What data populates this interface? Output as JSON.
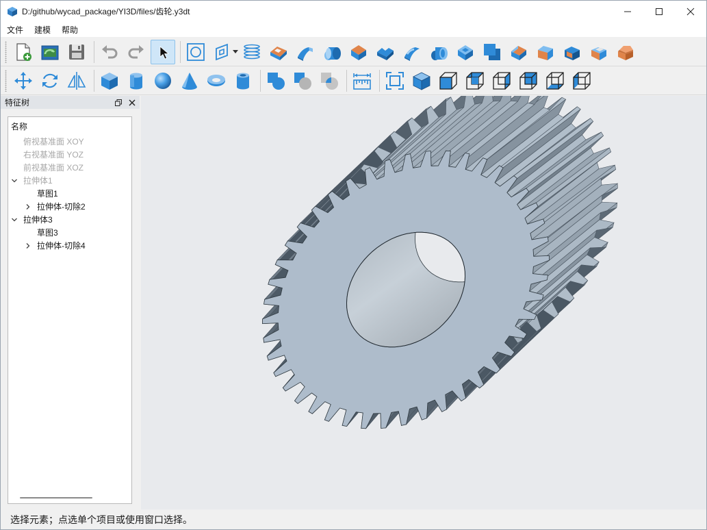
{
  "window": {
    "title": "D:/github/wycad_package/YI3D/files/齿轮.y3dt"
  },
  "menu": {
    "items": [
      "文件",
      "建模",
      "帮助"
    ]
  },
  "toolbar1": {
    "buttons": [
      "new-file-icon",
      "open-file-icon",
      "save-icon",
      "undo-icon",
      "redo-icon",
      "select-pointer-icon",
      "circle-sketch-icon",
      "plane-sketch-icon",
      "helix-icon",
      "extrude-icon",
      "revolve-icon",
      "sweep-icon",
      "loft-icon",
      "extrude-cut-icon",
      "revolve-cut-icon",
      "sweep-cut-icon",
      "loft-cut-icon",
      "shell-icon",
      "thicken-icon",
      "chamfer-icon",
      "fillet-icon",
      "draft-icon",
      "pyramid-icon"
    ],
    "selected": "select-pointer-icon"
  },
  "toolbar2": {
    "buttons": [
      "move-icon",
      "rotate-icon",
      "mirror-icon",
      "box-primitive-icon",
      "cylinder-primitive-icon",
      "sphere-primitive-icon",
      "cone-primitive-icon",
      "torus-primitive-icon",
      "pipe-primitive-icon",
      "boolean-union-icon",
      "boolean-cut-icon",
      "boolean-intersect-icon",
      "measure-icon",
      "fit-all-icon",
      "iso-view-icon",
      "front-view-icon",
      "top-view-icon",
      "right-view-icon",
      "back-view-icon",
      "bottom-view-icon",
      "left-view-icon"
    ]
  },
  "feature_tree": {
    "panel_title": "特征树",
    "column_header": "名称",
    "items": [
      {
        "label": "俯视基准面 XOY",
        "disabled": true,
        "level": 0,
        "arrow": ""
      },
      {
        "label": "右视基准面 YOZ",
        "disabled": true,
        "level": 0,
        "arrow": ""
      },
      {
        "label": "前视基准面 XOZ",
        "disabled": true,
        "level": 0,
        "arrow": ""
      },
      {
        "label": "拉伸体1",
        "disabled": true,
        "level": 0,
        "arrow": "expanded"
      },
      {
        "label": "草图1",
        "disabled": false,
        "level": 1,
        "arrow": ""
      },
      {
        "label": "拉伸体-切除2",
        "disabled": false,
        "level": 1,
        "arrow": "collapsed"
      },
      {
        "label": "拉伸体3",
        "disabled": false,
        "level": 0,
        "arrow": "expanded"
      },
      {
        "label": "草图3",
        "disabled": false,
        "level": 1,
        "arrow": ""
      },
      {
        "label": "拉伸体-切除4",
        "disabled": false,
        "level": 1,
        "arrow": "collapsed"
      }
    ]
  },
  "viewport": {
    "model": "helical-gear",
    "teeth": 44,
    "face_color": "#aebccb",
    "background": "#e8eaed"
  },
  "status": {
    "text": "选择元素；点选单个项目或使用窗口选择。"
  },
  "colors": {
    "accent_blue": "#2f8bd8",
    "orange": "#e0844a"
  }
}
